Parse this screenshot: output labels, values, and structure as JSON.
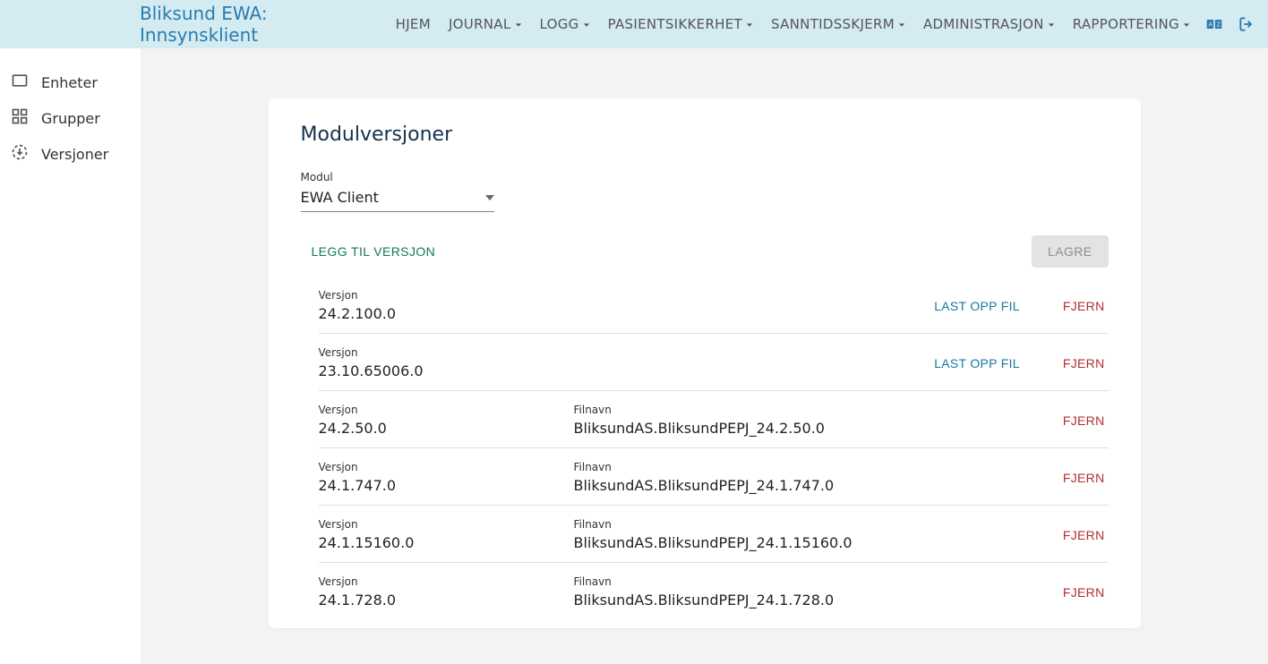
{
  "header": {
    "brand": "Bliksund EWA: Innsynsklient",
    "nav": [
      {
        "label": "HJEM",
        "dropdown": false
      },
      {
        "label": "JOURNAL",
        "dropdown": true
      },
      {
        "label": "LOGG",
        "dropdown": true
      },
      {
        "label": "PASIENTSIKKERHET",
        "dropdown": true
      },
      {
        "label": "SANNTIDSSKJERM",
        "dropdown": true
      },
      {
        "label": "ADMINISTRASJON",
        "dropdown": true
      },
      {
        "label": "RAPPORTERING",
        "dropdown": true
      }
    ]
  },
  "sidebar": {
    "items": [
      {
        "label": "Enheter"
      },
      {
        "label": "Grupper"
      },
      {
        "label": "Versjoner"
      }
    ]
  },
  "main": {
    "title": "Modulversjoner",
    "module_label": "Modul",
    "module_value": "EWA Client",
    "add_label": "LEGG TIL VERSJON",
    "save_label": "LAGRE",
    "upload_label": "LAST OPP FIL",
    "remove_label": "FJERN",
    "version_label": "Versjon",
    "filename_label": "Filnavn",
    "rows": [
      {
        "version": "24.2.100.0",
        "filename": null
      },
      {
        "version": "23.10.65006.0",
        "filename": null
      },
      {
        "version": "24.2.50.0",
        "filename": "BliksundAS.BliksundPEPJ_24.2.50.0"
      },
      {
        "version": "24.1.747.0",
        "filename": "BliksundAS.BliksundPEPJ_24.1.747.0"
      },
      {
        "version": "24.1.15160.0",
        "filename": "BliksundAS.BliksundPEPJ_24.1.15160.0"
      },
      {
        "version": "24.1.728.0",
        "filename": "BliksundAS.BliksundPEPJ_24.1.728.0"
      }
    ]
  }
}
